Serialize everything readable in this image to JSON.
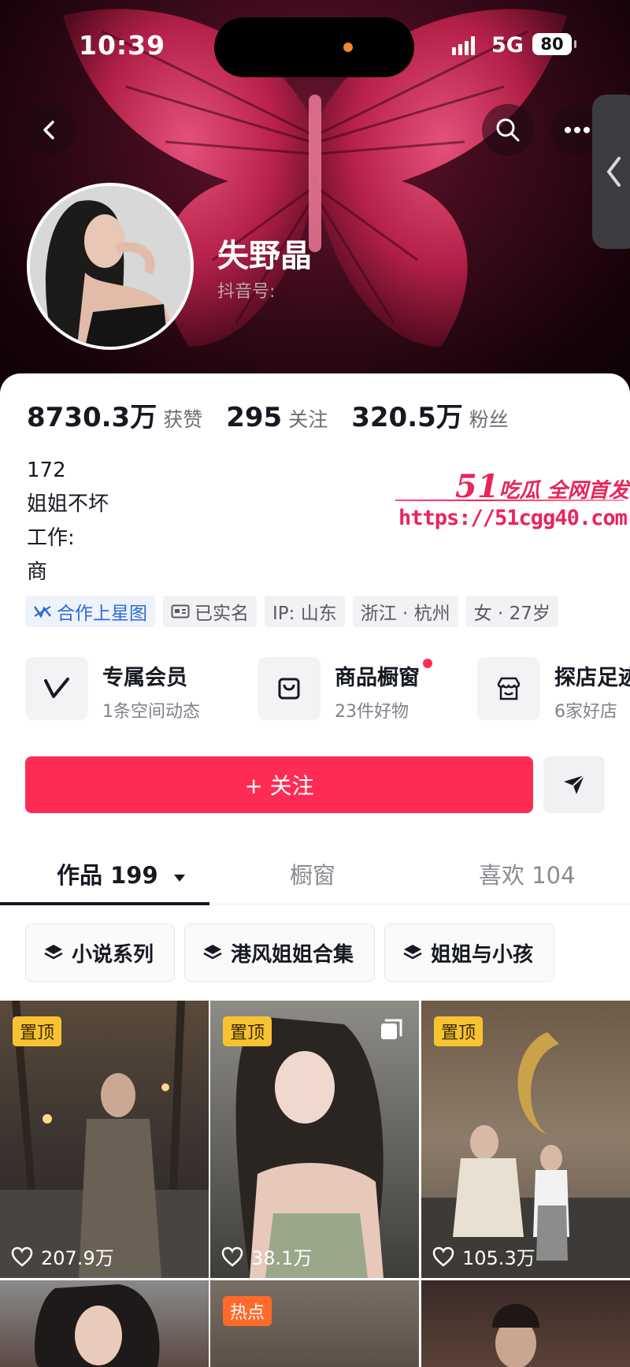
{
  "status_bar": {
    "time": "10:39",
    "network": "5G",
    "battery": "80"
  },
  "profile": {
    "name": "失野晶",
    "douyin_id_label": "抖音号:",
    "stats": [
      {
        "value": "8730.3万",
        "label": "获赞"
      },
      {
        "value": "295",
        "label": "关注"
      },
      {
        "value": "320.5万",
        "label": "粉丝"
      }
    ],
    "bio": [
      "172",
      "姐姐不坏",
      "工作:",
      "商"
    ],
    "tags": [
      "合作上星图",
      "已实名",
      "IP: 山东",
      "浙江 · 杭州",
      "女 · 27岁"
    ]
  },
  "watermark": {
    "brand_num": "51",
    "brand_text": "吃瓜 全网首发",
    "url": "https://51cgg40.com"
  },
  "shortcuts": [
    {
      "title": "专属会员",
      "subtitle": "1条空间动态"
    },
    {
      "title": "商品橱窗",
      "subtitle": "23件好物"
    },
    {
      "title": "探店足迹",
      "subtitle": "6家好店"
    }
  ],
  "follow_button": {
    "label": "+ 关注"
  },
  "tabs": {
    "works": "作品 199",
    "showcase": "橱窗",
    "likes": "喜欢 104"
  },
  "collections": [
    "小说系列",
    "港风姐姐合集",
    "姐姐与小孩"
  ],
  "videos": [
    {
      "badge": "置顶",
      "likes": "207.9万"
    },
    {
      "badge": "置顶",
      "likes": "38.1万"
    },
    {
      "badge": "置顶",
      "likes": "105.3万"
    },
    {
      "badge": "",
      "likes": ""
    },
    {
      "badge": "热点",
      "likes": ""
    },
    {
      "badge": "",
      "likes": ""
    }
  ],
  "colors": {
    "accent": "#fe2c55",
    "badge_pin": "#f8c333",
    "badge_hot": "#ff6a2b",
    "link_blue": "#2d6bd6"
  }
}
